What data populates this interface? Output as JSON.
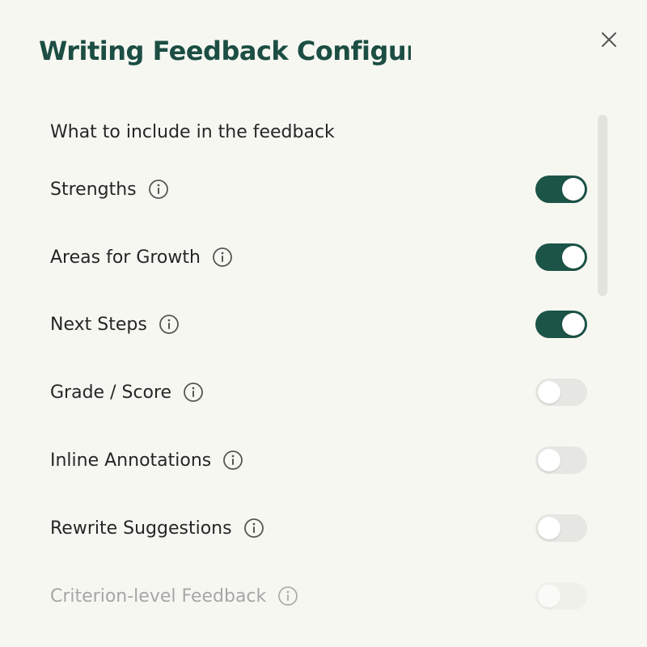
{
  "dialog": {
    "title": "Writing Feedback Configurati",
    "close_icon": "close-icon"
  },
  "section": {
    "heading": "What to include in the feedback"
  },
  "options": [
    {
      "label": "Strengths",
      "enabled": true
    },
    {
      "label": "Areas for Growth",
      "enabled": true
    },
    {
      "label": "Next Steps",
      "enabled": true
    },
    {
      "label": "Grade / Score",
      "enabled": false
    },
    {
      "label": "Inline Annotations",
      "enabled": false
    },
    {
      "label": "Rewrite Suggestions",
      "enabled": false
    },
    {
      "label": "Criterion-level Feedback",
      "enabled": false
    }
  ],
  "colors": {
    "accent": "#1c5448",
    "title": "#1c4e43",
    "background": "#f7f7f2",
    "toggle_off": "#e6e6e2"
  }
}
